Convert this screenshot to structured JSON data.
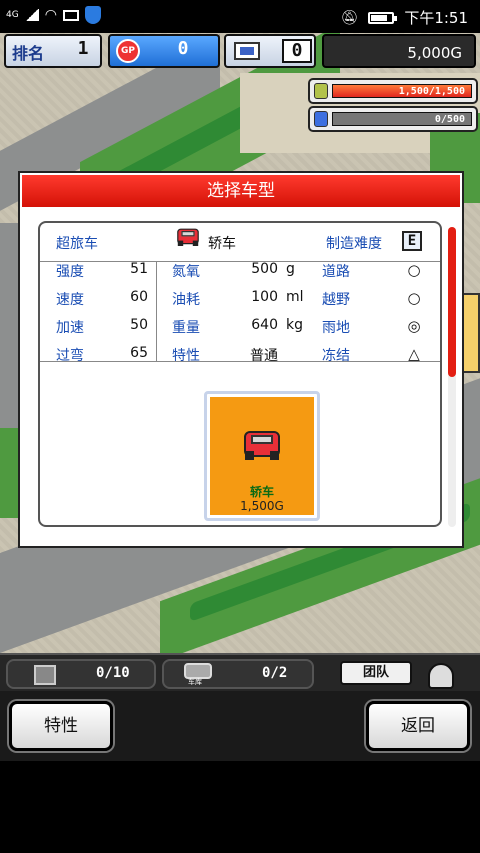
{
  "status_bar": {
    "signal_label": "4G",
    "time": "下午1:51",
    "icons": [
      "signal-icon",
      "wifi-icon",
      "mail-icon",
      "shield-icon",
      "mute-icon",
      "battery-icon"
    ]
  },
  "hud": {
    "ranking_label": "排名",
    "ranking_value": "1",
    "gp_label": "GP",
    "gp_value": "0",
    "pc_value": "0",
    "money": "5,000G"
  },
  "resources": {
    "fuel_text": "1,500/1,500",
    "fuel_fill": 1.0,
    "research_text": "0/500",
    "research_fill": 0.0
  },
  "dialog": {
    "title": "选择车型",
    "header": {
      "class": "超旅车",
      "type_name": "轿车",
      "difficulty_label": "制造难度",
      "difficulty_value": "E"
    },
    "stats": [
      {
        "label": "强度",
        "value": "51"
      },
      {
        "label": "速度",
        "value": "60"
      },
      {
        "label": "加速",
        "value": "50"
      },
      {
        "label": "过弯",
        "value": "65"
      }
    ],
    "specs": [
      {
        "label": "氮氧",
        "value": "500",
        "unit": "g"
      },
      {
        "label": "油耗",
        "value": "100",
        "unit": "ml"
      },
      {
        "label": "重量",
        "value": "640",
        "unit": "kg"
      },
      {
        "label": "特性",
        "value": "普通",
        "unit": ""
      }
    ],
    "terrain": [
      {
        "label": "道路",
        "mark": "○"
      },
      {
        "label": "越野",
        "mark": "○"
      },
      {
        "label": "雨地",
        "mark": "◎"
      },
      {
        "label": "冻结",
        "mark": "△"
      }
    ],
    "car_card": {
      "name": "轿车",
      "price": "1,500G"
    }
  },
  "bottom_bar": {
    "parts_value": "0/10",
    "cars_value": "0/2",
    "cars_icon_label": "车库",
    "team_label": "团队"
  },
  "actions": {
    "left_label": "特性",
    "right_label": "返回"
  },
  "colors": {
    "title_red": "#e01a0f",
    "label_blue": "#1a4db3",
    "card_orange": "#f59a12",
    "car_name_green": "#0a6a14"
  }
}
